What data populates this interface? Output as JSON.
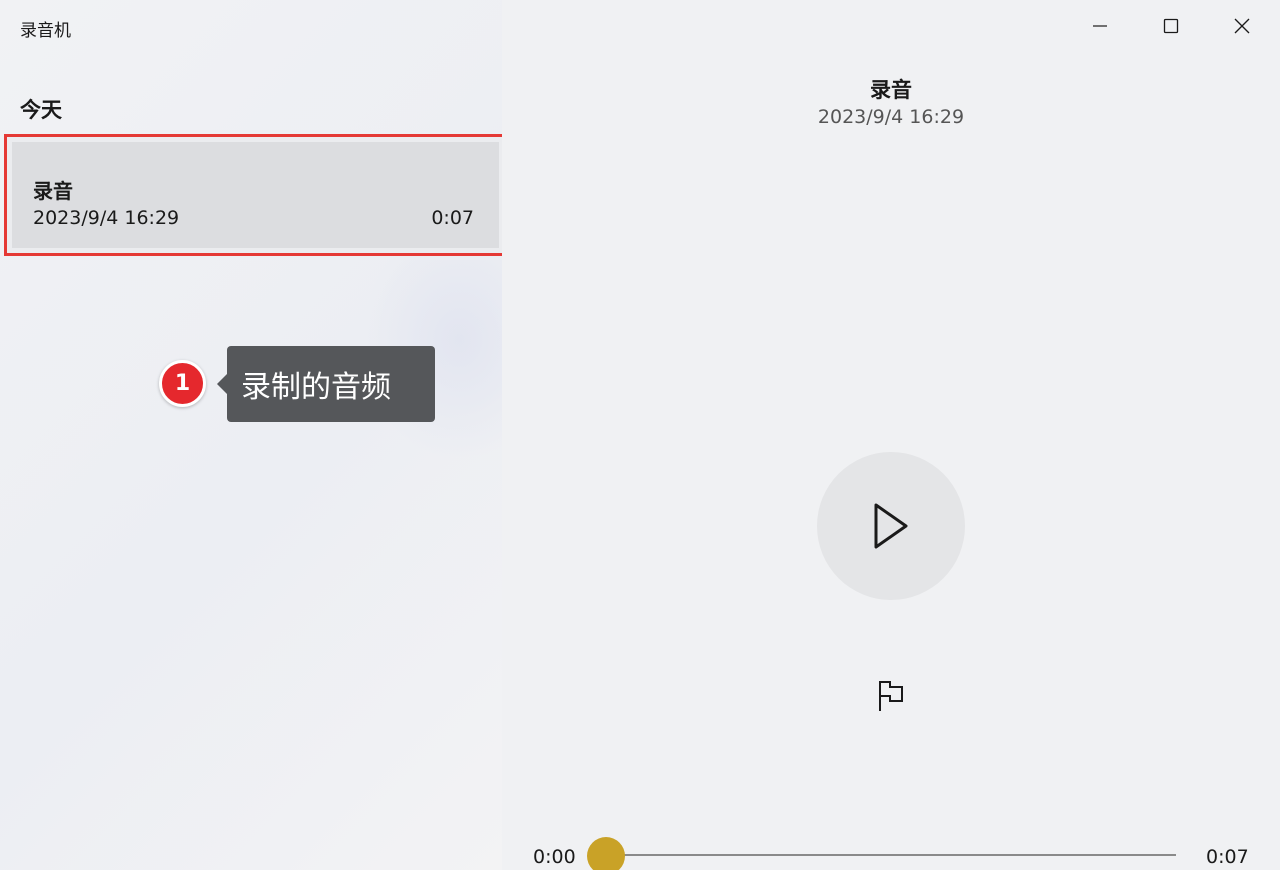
{
  "window": {
    "title": "录音机",
    "controls": {
      "minimize_icon": "minimize-icon",
      "maximize_icon": "maximize-icon",
      "close_icon": "close-icon"
    }
  },
  "sidebar": {
    "section_header": "今天",
    "recordings": [
      {
        "name": "录音",
        "date": "2023/9/4 16:29",
        "duration": "0:07",
        "selected": true
      }
    ]
  },
  "annotation": {
    "step_number": "1",
    "callout_text": "录制的音频",
    "highlight_color": "#e53935"
  },
  "player": {
    "title": "录音",
    "date": "2023/9/4 16:29",
    "play_icon": "play-icon",
    "marker_icon": "flag-icon",
    "current_time": "0:00",
    "total_time": "0:07",
    "progress": 0,
    "accent_color": "#c9a227"
  }
}
